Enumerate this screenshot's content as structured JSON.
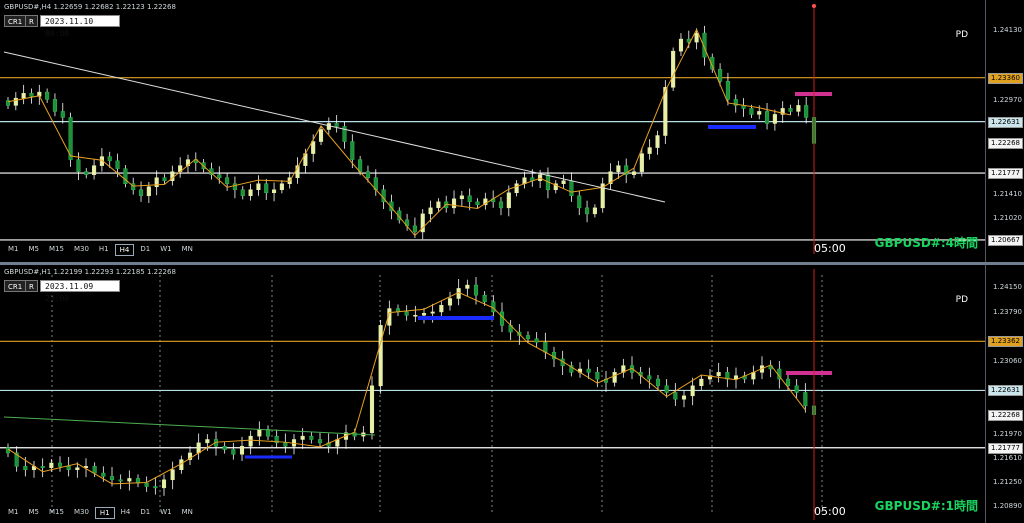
{
  "charts": [
    {
      "id": "h4",
      "header": "GBPUSD#,H4  1.22659 1.22682 1.22123 1.22268",
      "buttons": [
        "CR1",
        "R"
      ],
      "datetime": "2023.11.10 00:00",
      "timeframes": [
        "M1",
        "M5",
        "M15",
        "M30",
        "H1",
        "H4",
        "D1",
        "W1",
        "MN"
      ],
      "active_timeframe": "H4",
      "pd_label": "PD",
      "title": "GBPUSD#:4時間",
      "time_label": "05:00",
      "price_ticks": [
        "1.24130",
        "1.23360",
        "1.22970",
        "1.22631",
        "1.22268",
        "1.21777",
        "1.21410",
        "1.21020",
        "1.20667"
      ],
      "highlighted_ticks": {
        "1.23360": "orange",
        "1.22631": "lightblue",
        "1.22268": "white",
        "1.21777": "white",
        "1.20667": "white"
      }
    },
    {
      "id": "h1",
      "header": "GBPUSD#,H1  1.22199 1.22293 1.22185 1.22268",
      "buttons": [
        "CR1",
        "R"
      ],
      "datetime": "2023.11.09 23:00",
      "timeframes": [
        "M1",
        "M5",
        "M15",
        "M30",
        "H1",
        "H4",
        "D1",
        "W1",
        "MN"
      ],
      "active_timeframe": "H1",
      "pd_label": "PD",
      "title": "GBPUSD#:1時間",
      "time_label": "05:00",
      "price_ticks": [
        "1.24150",
        "1.23790",
        "1.23362",
        "1.23060",
        "1.22631",
        "1.22268",
        "1.21970",
        "1.21777",
        "1.21610",
        "1.21250",
        "1.20890"
      ],
      "highlighted_ticks": {
        "1.23362": "orange",
        "1.22631": "lightblue",
        "1.22268": "white",
        "1.21777": "white"
      }
    }
  ],
  "chart_data": [
    {
      "type": "candlestick",
      "symbol": "GBPUSD#",
      "timeframe": "H4",
      "ylim": [
        1.206,
        1.2435
      ],
      "last": {
        "open": 1.22659,
        "high": 1.22682,
        "low": 1.22123,
        "close": 1.22268
      },
      "horizontal_levels": [
        {
          "price": 1.2336,
          "color": "#e0a020"
        },
        {
          "price": 1.22631,
          "color": "#b8dce8"
        },
        {
          "price": 1.21777,
          "color": "#ffffff"
        },
        {
          "price": 1.20667,
          "color": "#ffffff"
        }
      ],
      "closes": [
        1.229,
        1.2302,
        1.231,
        1.2305,
        1.2312,
        1.23,
        1.228,
        1.227,
        1.22,
        1.218,
        1.2175,
        1.219,
        1.2205,
        1.2198,
        1.2185,
        1.216,
        1.215,
        1.214,
        1.2155,
        1.217,
        1.2165,
        1.218,
        1.219,
        1.22,
        1.2195,
        1.2185,
        1.2175,
        1.217,
        1.216,
        1.215,
        1.214,
        1.215,
        1.216,
        1.2145,
        1.215,
        1.216,
        1.217,
        1.219,
        1.221,
        1.223,
        1.225,
        1.226,
        1.2255,
        1.223,
        1.22,
        1.218,
        1.217,
        1.215,
        1.213,
        1.2115,
        1.21,
        1.209,
        1.208,
        1.211,
        1.212,
        1.213,
        1.212,
        1.2135,
        1.214,
        1.213,
        1.2125,
        1.2135,
        1.213,
        1.212,
        1.2145,
        1.216,
        1.217,
        1.2165,
        1.2175,
        1.215,
        1.216,
        1.2165,
        1.214,
        1.212,
        1.211,
        1.212,
        1.216,
        1.218,
        1.219,
        1.2175,
        1.218,
        1.221,
        1.222,
        1.224,
        1.232,
        1.238,
        1.24,
        1.2395,
        1.241,
        1.237,
        1.235,
        1.233,
        1.23,
        1.229,
        1.2285,
        1.2275,
        1.228,
        1.226,
        1.2275,
        1.2285,
        1.228,
        1.229,
        1.227,
        1.2227
      ]
    },
    {
      "type": "candlestick",
      "symbol": "GBPUSD#",
      "timeframe": "H1",
      "ylim": [
        1.2085,
        1.2435
      ],
      "last": {
        "open": 1.22199,
        "high": 1.22293,
        "low": 1.22185,
        "close": 1.22268
      },
      "horizontal_levels": [
        {
          "price": 1.23362,
          "color": "#e0a020"
        },
        {
          "price": 1.22631,
          "color": "#b8dce8"
        },
        {
          "price": 1.21777,
          "color": "#ffffff"
        }
      ],
      "closes": [
        1.217,
        1.215,
        1.2145,
        1.215,
        1.2148,
        1.2155,
        1.215,
        1.2145,
        1.2148,
        1.215,
        1.214,
        1.2135,
        1.213,
        1.2128,
        1.2132,
        1.2125,
        1.212,
        1.2118,
        1.213,
        1.2145,
        1.216,
        1.217,
        1.2185,
        1.219,
        1.218,
        1.2175,
        1.2168,
        1.218,
        1.2195,
        1.2205,
        1.2195,
        1.2185,
        1.218,
        1.219,
        1.2195,
        1.219,
        1.2185,
        1.218,
        1.219,
        1.22,
        1.2195,
        1.22,
        1.227,
        1.236,
        1.2385,
        1.238,
        1.2375,
        1.2375,
        1.2378,
        1.238,
        1.239,
        1.24,
        1.2415,
        1.242,
        1.2405,
        1.2395,
        1.238,
        1.236,
        1.235,
        1.2345,
        1.234,
        1.2335,
        1.232,
        1.231,
        1.23,
        1.229,
        1.2295,
        1.229,
        1.228,
        1.2275,
        1.229,
        1.23,
        1.229,
        1.2285,
        1.228,
        1.227,
        1.226,
        1.225,
        1.2255,
        1.227,
        1.228,
        1.2285,
        1.229,
        1.228,
        1.2285,
        1.228,
        1.229,
        1.23,
        1.2295,
        1.228,
        1.227,
        1.226,
        1.224,
        1.2227
      ]
    }
  ]
}
